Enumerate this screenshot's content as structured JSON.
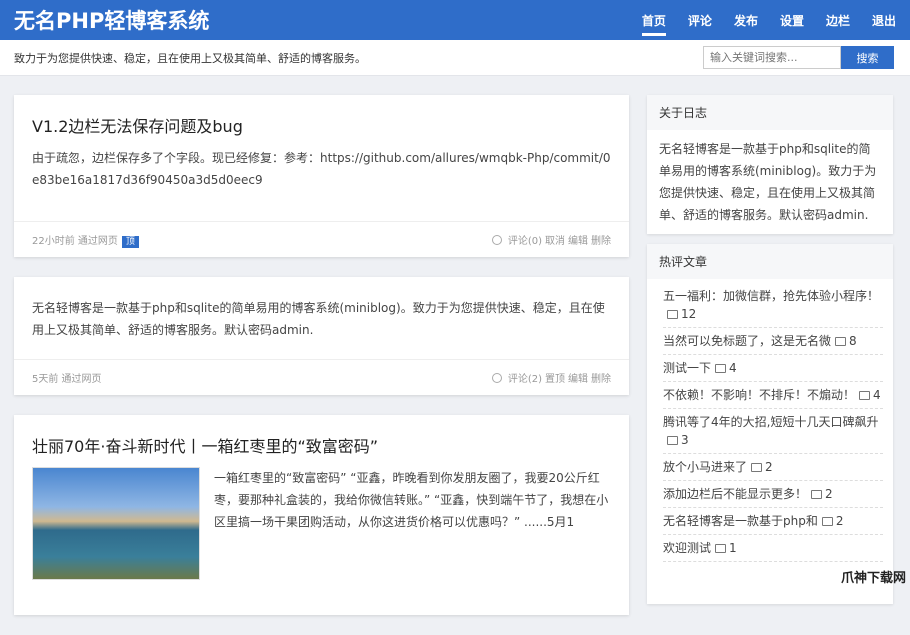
{
  "header": {
    "title": "无名PHP轻博客系统",
    "nav": [
      "首页",
      "评论",
      "发布",
      "设置",
      "边栏",
      "退出"
    ]
  },
  "subheader": {
    "slogan": "致力于为您提供快速、稳定，且在使用上又极其简单、舒适的博客服务。",
    "search_placeholder": "输入关键词搜索...",
    "search_button": "搜索"
  },
  "posts": [
    {
      "title": "V1.2边栏无法保存问题及bug",
      "text": "由于疏忽，边栏保存多了个字段。现已经修复：参考：https://github.com/allures/wmqbk-Php/commit/0e83be16a1817d36f90450a3d5d0eec9",
      "time": "22小时前 通过网页",
      "badge": "顶",
      "comments": "评论(0)",
      "actions": [
        "取消",
        "编辑",
        "删除"
      ]
    },
    {
      "text": "无名轻博客是一款基于php和sqlite的简单易用的博客系统(miniblog)。致力于为您提供快速、稳定，且在使用上又极其简单、舒适的博客服务。默认密码admin.",
      "time": "5天前 通过网页",
      "comments": "评论(2)",
      "actions": [
        "置顶",
        "编辑",
        "删除"
      ]
    },
    {
      "title": "壮丽70年·奋斗新时代丨一箱红枣里的“致富密码”",
      "text": "一箱红枣里的“致富密码” “亚鑫，昨晚看到你发朋友圈了，我要20公斤红枣，要那种礼盒装的，我给你微信转账。” “亚鑫，快到端午节了，我想在小区里搞一场干果团购活动，从你这进货价格可以优惠吗？” ......5月1"
    }
  ],
  "sidebar": {
    "about": {
      "title": "关于日志",
      "text": "无名轻博客是一款基于php和sqlite的简单易用的博客系统(miniblog)。致力于为您提供快速、稳定，且在使用上又极其简单、舒适的博客服务。默认密码admin."
    },
    "hot": {
      "title": "热评文章",
      "items": [
        {
          "title": "五一福利：加微信群，抢先体验小程序！",
          "count": "12"
        },
        {
          "title": "当然可以免标题了，这是无名微",
          "count": "8"
        },
        {
          "title": "测试一下",
          "count": "4"
        },
        {
          "title": "不依赖！不影响！不排斥！不煽动！",
          "count": "4"
        },
        {
          "title": "腾讯等了4年的大招,短短十几天口碑飙升",
          "count": "3"
        },
        {
          "title": "放个小马进来了",
          "count": "2"
        },
        {
          "title": "添加边栏后不能显示更多！",
          "count": "2"
        },
        {
          "title": "无名轻博客是一款基于php和",
          "count": "2"
        },
        {
          "title": "欢迎测试",
          "count": "1"
        }
      ]
    }
  },
  "watermark": "爪神下载网"
}
